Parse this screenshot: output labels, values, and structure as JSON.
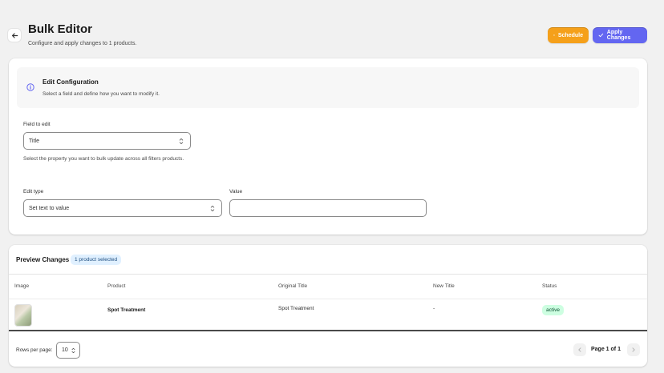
{
  "header": {
    "title": "Bulk Editor",
    "subtitle": "Configure and apply changes to 1 products.",
    "back_icon": "arrow-left-icon",
    "schedule_label": "Schedule",
    "apply_label": "Apply Changes",
    "schedule_color": "#f5a01a",
    "apply_color": "#6366f1"
  },
  "config": {
    "title": "Edit Configuration",
    "description": "Select a field and define how you want to modify it.",
    "field_label": "Field to edit",
    "field_value": "Title",
    "field_help": "Select the property you want to bulk update across all filters products.",
    "edit_type_label": "Edit type",
    "edit_type_value": "Set text to value",
    "value_label": "Value",
    "value_value": ""
  },
  "preview": {
    "title": "Preview Changes",
    "selected_badge": "1 product selected",
    "columns": [
      "Image",
      "Product",
      "Original Title",
      "New Title",
      "Status"
    ],
    "rows": [
      {
        "product": "Spot Treatment",
        "original_title": "Spot Treatment",
        "new_title": "-",
        "status": "active"
      }
    ],
    "rows_per_page_label": "Rows per page:",
    "rows_per_page_value": "10",
    "page_label": "Page 1 of 1"
  }
}
